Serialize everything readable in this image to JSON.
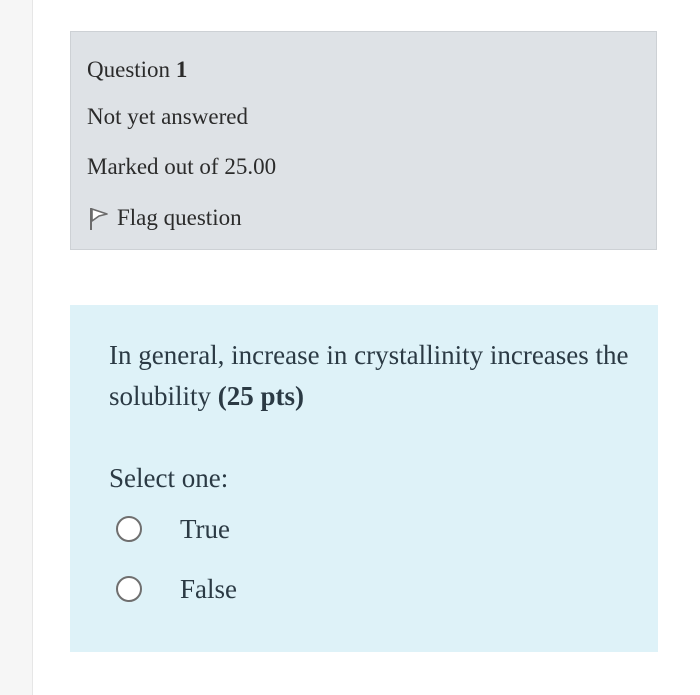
{
  "question_info": {
    "title_prefix": "Question",
    "number": "1",
    "state": "Not yet answered",
    "grade": "Marked out of 25.00",
    "flag_label": "Flag question"
  },
  "question": {
    "text": "In general, increase in crystallinity increases the solubility",
    "points": "(25 pts)",
    "prompt": "Select one:",
    "options": [
      {
        "label": "True",
        "selected": false
      },
      {
        "label": "False",
        "selected": false
      }
    ]
  },
  "colors": {
    "info_background": "#dee2e6",
    "content_background": "#def2f8"
  },
  "icons": {
    "flag": "flag-icon",
    "radio": "radio-button"
  }
}
